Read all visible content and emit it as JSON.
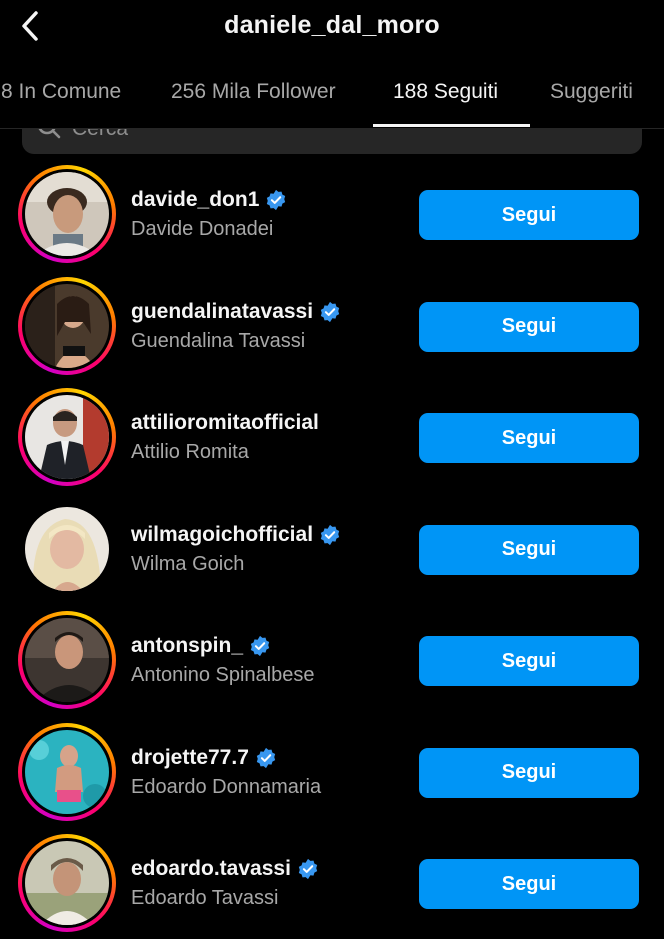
{
  "header": {
    "title": "daniele_dal_moro",
    "back_icon": "chevron-left-icon"
  },
  "tabs": [
    {
      "label": "8 In Comune",
      "active": false
    },
    {
      "label": "256 Mila Follower",
      "active": false
    },
    {
      "label": "188 Seguiti",
      "active": true
    },
    {
      "label": "Suggeriti",
      "active": false
    }
  ],
  "search": {
    "placeholder": "Cerca",
    "icon": "search-icon"
  },
  "users": [
    {
      "username": "davide_don1",
      "full_name": "Davide Donadei",
      "verified": true,
      "story": true,
      "button": "Segui"
    },
    {
      "username": "guendalinatavassi",
      "full_name": "Guendalina Tavassi",
      "verified": true,
      "story": true,
      "button": "Segui"
    },
    {
      "username": "attilioromitaofficial",
      "full_name": "Attilio Romita",
      "verified": false,
      "story": true,
      "button": "Segui"
    },
    {
      "username": "wilmagoichofficial",
      "full_name": "Wilma Goich",
      "verified": true,
      "story": false,
      "button": "Segui"
    },
    {
      "username": "antonspin_",
      "full_name": "Antonino Spinalbese",
      "verified": true,
      "story": true,
      "button": "Segui"
    },
    {
      "username": "drojette77.7",
      "full_name": "Edoardo Donnamaria",
      "verified": true,
      "story": true,
      "button": "Segui"
    },
    {
      "username": "edoardo.tavassi",
      "full_name": "Edoardo Tavassi",
      "verified": true,
      "story": true,
      "button": "Segui"
    }
  ],
  "colors": {
    "background": "#000000",
    "button": "#0095f6",
    "verified": "#3897f0",
    "secondary_text": "#a8a8a8"
  }
}
